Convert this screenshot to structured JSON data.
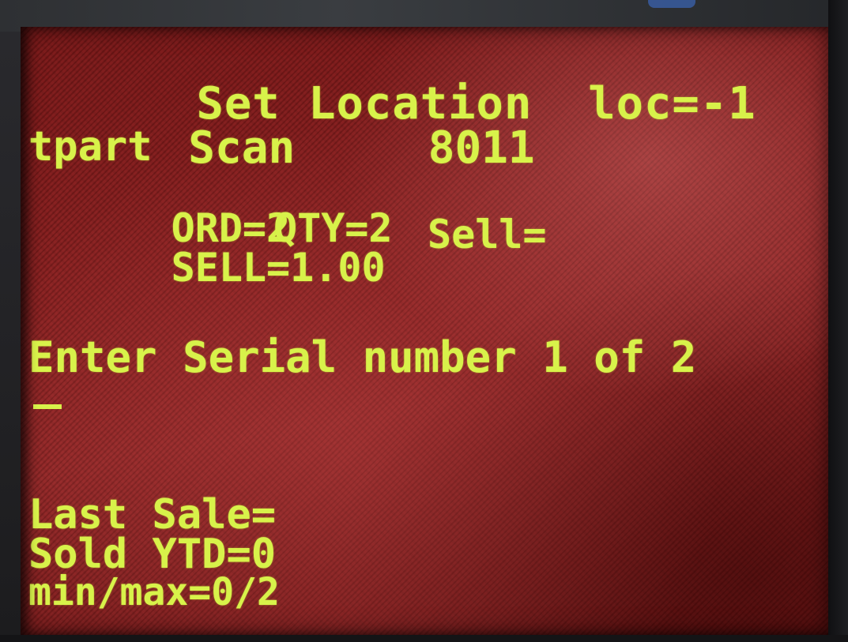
{
  "header": {
    "title": "Set Location",
    "loc": "loc=-1"
  },
  "scan": {
    "label": "Scan",
    "value": "8011"
  },
  "part": {
    "name": "tpart"
  },
  "order": {
    "ord": "ORD=2",
    "qty": "QTY=2"
  },
  "price": {
    "sell": "SELL=1.00",
    "sell_input": "Sell="
  },
  "prompt": {
    "text": "Enter Serial number 1 of 2"
  },
  "input": {
    "cursor": "_"
  },
  "stats": {
    "last_sale": "Last Sale=",
    "sold_ytd": "Sold YTD=0",
    "min_max": "min/max=0/2"
  },
  "colors": {
    "text": "#d8f24a",
    "background": "#8b2020"
  }
}
